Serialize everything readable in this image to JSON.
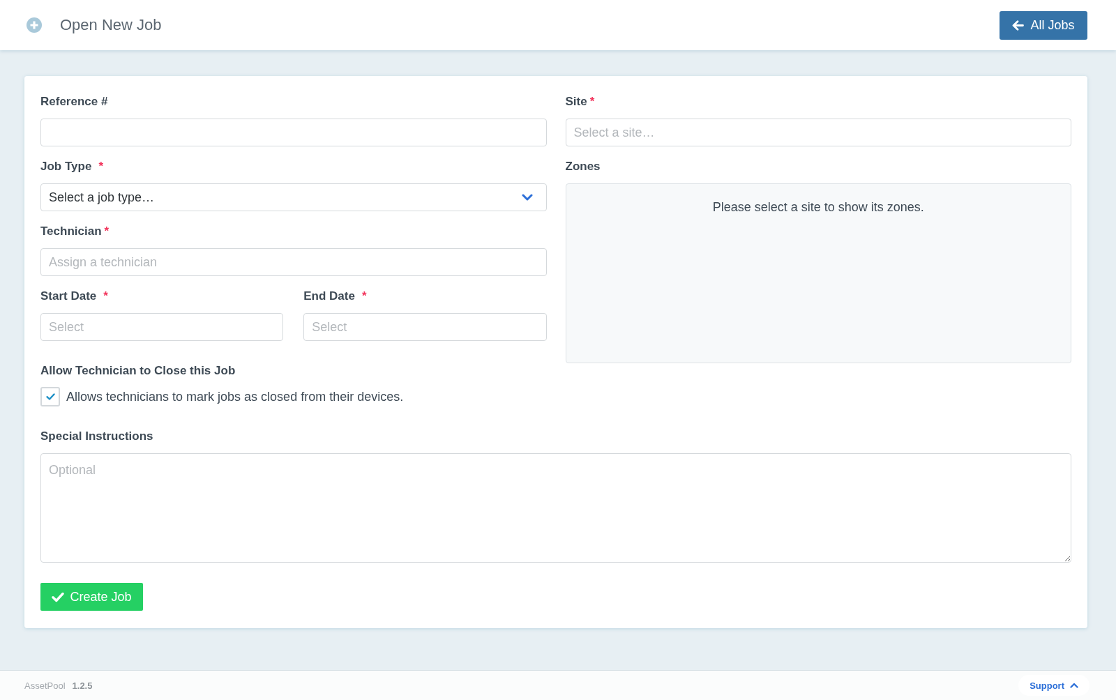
{
  "header": {
    "title": "Open New Job",
    "back_button": "All Jobs"
  },
  "form": {
    "left_fields": [
      {
        "kind": "text",
        "label": "Reference #"
      },
      {
        "kind": "select",
        "label": "Job Type",
        "required_mark": "*",
        "value": "Select a job type…"
      },
      {
        "kind": "text",
        "label": "Technician",
        "required_mark": "*",
        "placeholder": "Assign a technician"
      }
    ],
    "dates": [
      {
        "label": "Start Date",
        "required_mark": "*",
        "placeholder": "Select"
      },
      {
        "label": "End Date",
        "required_mark": "*",
        "placeholder": "Select"
      }
    ],
    "allow_close": {
      "label": "Allow Technician to Close this Job",
      "text": "Allows technicians to mark jobs as closed from their devices.",
      "checked": true
    },
    "site": {
      "label": "Site",
      "required_mark": "*",
      "placeholder": "Select a site…"
    },
    "zones": {
      "label": "Zones",
      "message": "Please select a site to show its zones."
    },
    "instructions": {
      "label": "Special Instructions",
      "placeholder": "Optional"
    },
    "submit_button": "Create Job"
  },
  "footer": {
    "app_name": "AssetPool",
    "version": "1.2.5",
    "support_link": "Support"
  }
}
